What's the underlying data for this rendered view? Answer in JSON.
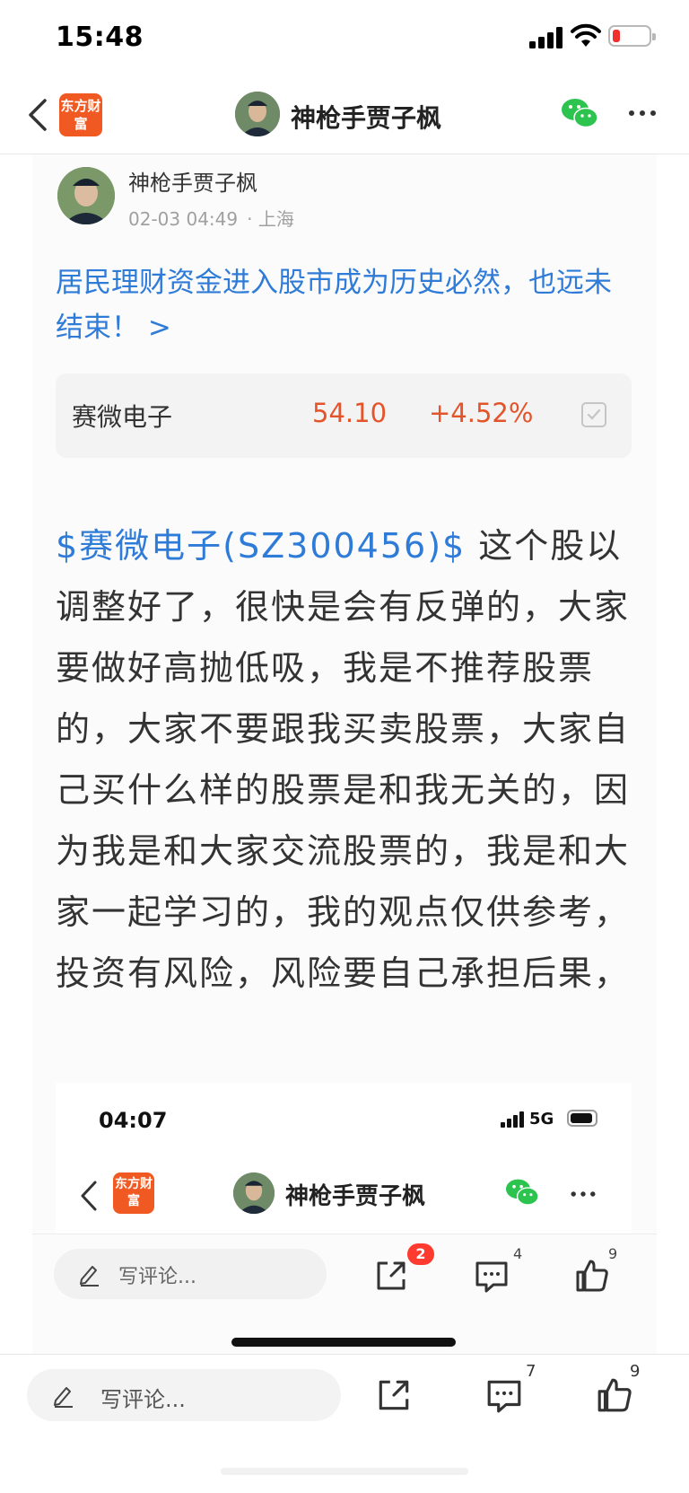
{
  "status_bar": {
    "time": "15:48"
  },
  "nav": {
    "logo_text": "东方财富",
    "title": "神枪手贾子枫"
  },
  "post": {
    "author": "神枪手贾子枫",
    "date": "02-03 04:49",
    "location": "· 上海",
    "title_link": "居民理财资金进入股市成为历史必然，也远未结束！ >",
    "stock": {
      "name": "赛微电子",
      "price": "54.10",
      "change": "+4.52%"
    },
    "stock_tag": "$赛微电子(SZ300456)$",
    "body": " 这个股以调整好了，很快是会有反弹的，大家要做好高抛低吸，我是不推荐股票的，大家不要跟我买卖股票，大家自己买什么样的股票是和我无关的，因为我是和大家交流股票的，我是和大家一起学习的，我的观点仅供参考，投资有风险，风险要自己承担后果，"
  },
  "embedded_screenshot": {
    "time": "04:07",
    "network": "5G",
    "logo_text": "东方财富",
    "title": "神枪手贾子枫",
    "comment_placeholder": "写评论...",
    "share_badge": "2",
    "comment_count": "4",
    "like_count": "9"
  },
  "bottom_bar": {
    "comment_placeholder": "写评论...",
    "comment_count": "7",
    "like_count": "9"
  },
  "colors": {
    "accent_blue": "#2f7bd8",
    "price_red": "#e3542a",
    "logo_orange": "#f05a22",
    "badge_red": "#ff3b30"
  }
}
